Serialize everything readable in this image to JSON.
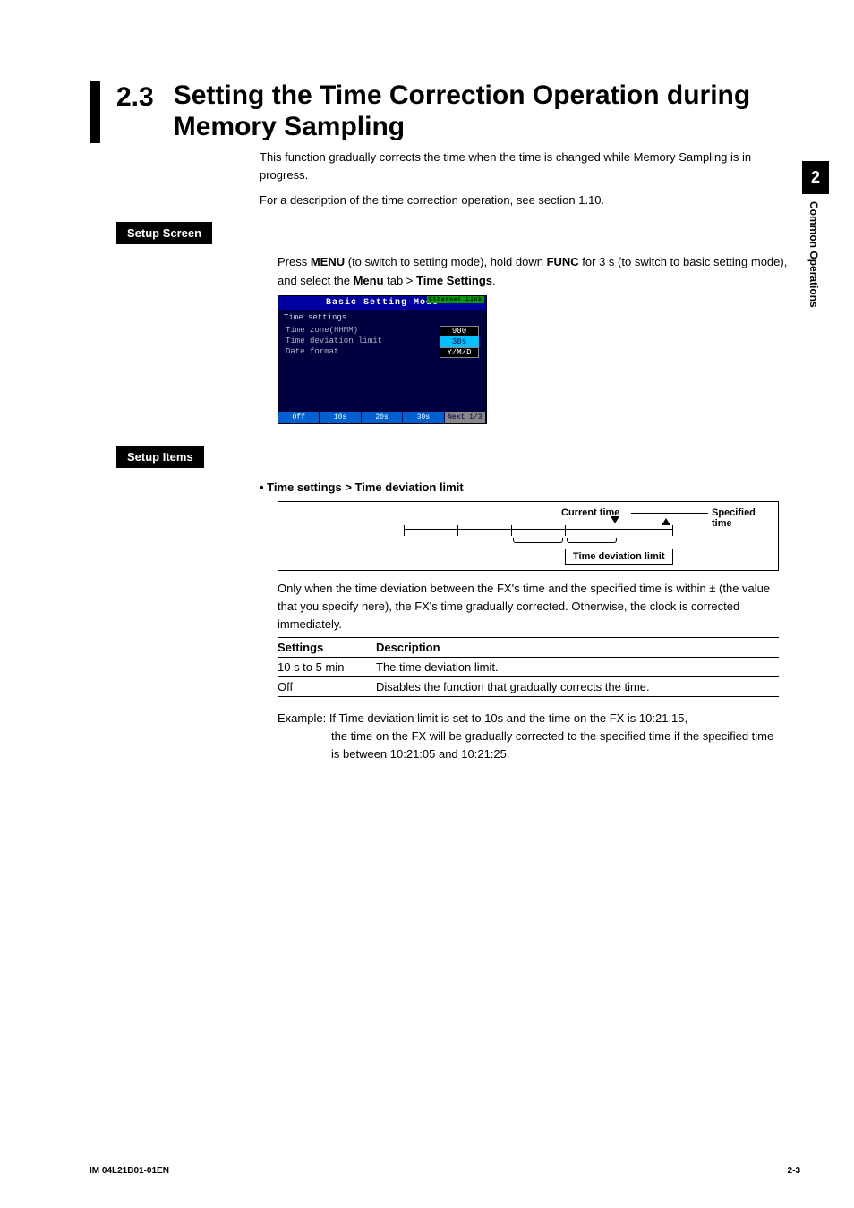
{
  "side": {
    "chapter": "2",
    "label": "Common Operations"
  },
  "section": {
    "num": "2.3",
    "title": "Setting the Time Correction Operation during Memory Sampling"
  },
  "intro": {
    "p1": "This function gradually corrects the time when the time is changed while Memory Sampling is in progress.",
    "p2": "For a description of the time correction operation, see section 1.10."
  },
  "setup_screen": {
    "heading": "Setup Screen",
    "instruction_pre": "Press ",
    "menu": "MENU",
    "instruction_mid1": " (to switch to setting mode), hold down ",
    "func": "FUNC",
    "instruction_mid2": " for 3 s (to switch to basic setting mode), and select the ",
    "menu_tab": "Menu",
    "greater": " tab > ",
    "time_settings": "Time Settings",
    "period": "."
  },
  "screen": {
    "title": "Basic Setting Mode",
    "eth": "Ethernet Link",
    "header": "Time settings",
    "rows": {
      "r1_label": "Time zone(HHMM)",
      "r1_val": "900",
      "r2_label": "Time deviation limit",
      "r2_val": "30s",
      "r3_label": "Date format",
      "r3_val": "Y/M/D"
    },
    "softkeys": {
      "k1": "Off",
      "k2": "10s",
      "k3": "20s",
      "k4": "30s",
      "k5": "Next 1/3"
    }
  },
  "setup_items": {
    "heading": "Setup Items",
    "bullet": "Time settings > Time deviation limit",
    "diagram": {
      "current_time": "Current time",
      "specified_time": "Specified time",
      "box": "Time deviation limit"
    },
    "para": "Only when the time deviation between the FX's time and the specified time is within ± (the value that you specify here), the FX's time gradually corrected. Otherwise, the clock is corrected immediately.",
    "table": {
      "h1": "Settings",
      "h2": "Description",
      "r1c1": "10 s to 5 min",
      "r1c2": "The time deviation limit.",
      "r2c1": "Off",
      "r2c2": "Disables the function that gradually corrects the time."
    },
    "example_label": "Example: ",
    "example_l1": "If Time deviation limit is set to 10s and the time on the FX is 10:21:15,",
    "example_l2": "the time on the FX will be gradually corrected to the specified time if the specified time is between 10:21:05 and 10:21:25."
  },
  "footer": {
    "left": "IM 04L21B01-01EN",
    "right": "2-3"
  }
}
